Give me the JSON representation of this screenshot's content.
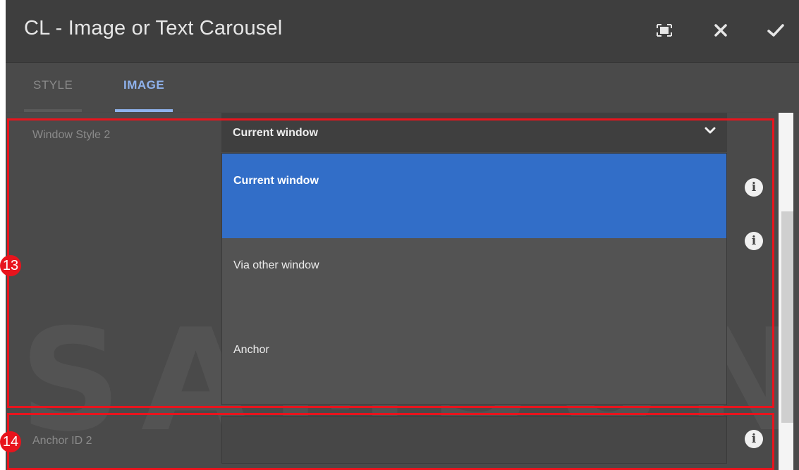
{
  "dialog": {
    "title": "CL - Image or Text Carousel",
    "buttons": [
      {
        "name": "fullscreen",
        "icon": "fullscreen-icon"
      },
      {
        "name": "close",
        "icon": "close-icon"
      },
      {
        "name": "done",
        "icon": "check-icon"
      }
    ]
  },
  "tabs": [
    {
      "label": "STYLE",
      "active": false
    },
    {
      "label": "IMAGE",
      "active": true
    }
  ],
  "fields": {
    "window_style": {
      "label": "Window Style 2",
      "selected": "Current window",
      "options": [
        "Current window",
        "Via other window",
        "Anchor"
      ],
      "highlighted_option": "Current window"
    },
    "anchor_id": {
      "label": "Anchor ID 2",
      "value": ""
    }
  },
  "watermark": "SAMSUNG",
  "annotations": [
    {
      "number": "13"
    },
    {
      "number": "14"
    }
  ],
  "colors": {
    "accent": "#326ec8",
    "tab_active": "#8fb2ec",
    "annotation": "#e8141d"
  }
}
